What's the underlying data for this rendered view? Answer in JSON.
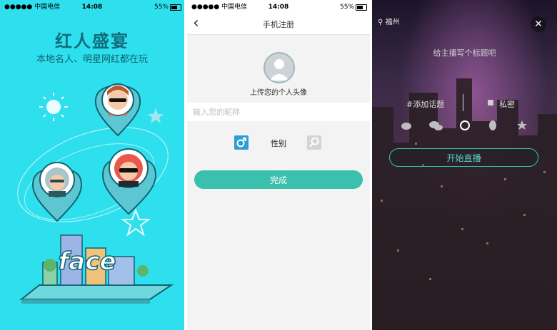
{
  "status_bar": {
    "carrier": "●●●●● 中国电信",
    "time": "14:08",
    "battery": "55%"
  },
  "splash": {
    "title": "红人盛宴",
    "subtitle": "本地名人、明星网红都在玩",
    "logo_text": "face",
    "colors": {
      "background": "#2ee0ee",
      "accent": "#116b7a"
    }
  },
  "register": {
    "nav_title": "手机注册",
    "upload_avatar_label": "上传您的个人头像",
    "nickname_placeholder": "输入您的昵称",
    "nickname_value": "",
    "gender_label": "性别",
    "gender_male_icon": "male-icon",
    "gender_female_icon": "female-icon",
    "done_button": "完成",
    "colors": {
      "button": "#3cc0ae",
      "male": "#2b9fd6"
    }
  },
  "live": {
    "location": "福州",
    "title_placeholder": "给主播写个标题吧",
    "topic_label": "#添加话题",
    "private_label": "私密",
    "share_icons": [
      "weibo-icon",
      "wechat-icon",
      "moments-icon",
      "qq-icon",
      "qzone-icon"
    ],
    "start_button": "开始直播",
    "colors": {
      "accent": "#39c3b0"
    }
  }
}
